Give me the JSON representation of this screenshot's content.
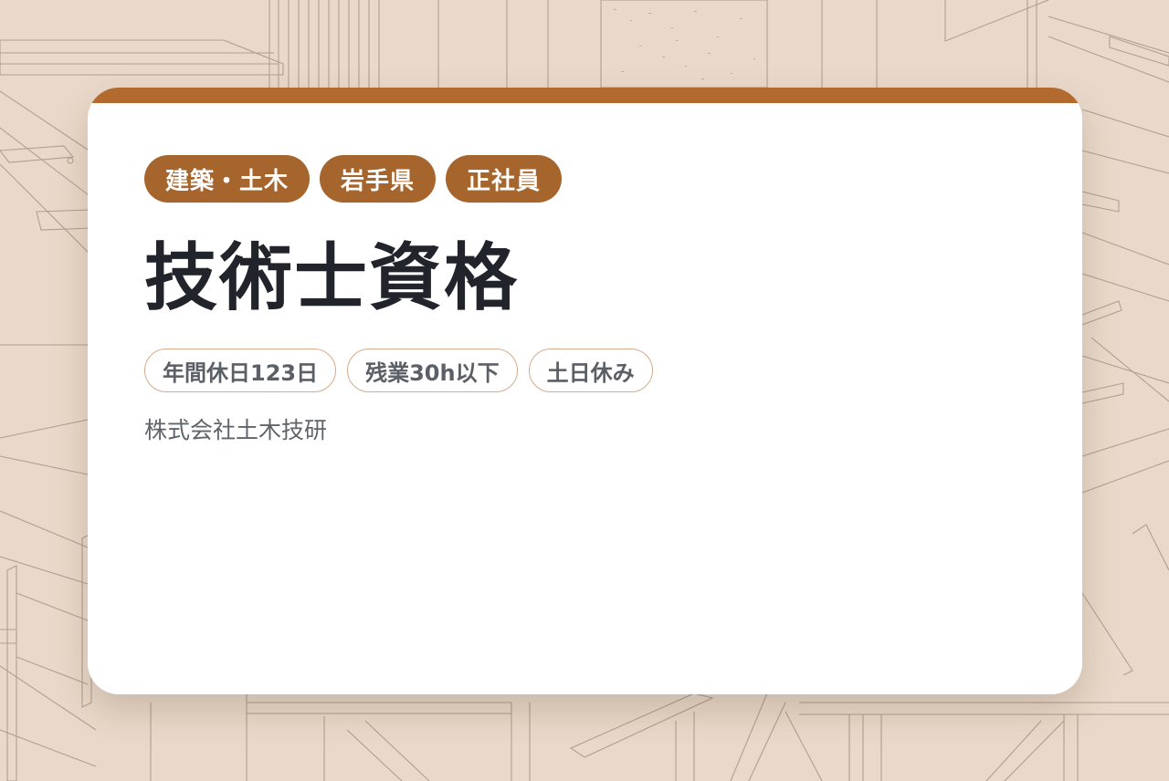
{
  "colors": {
    "background": "#ead9ca",
    "accent": "#b26a2e",
    "tag_background": "#a7652e",
    "title_text": "#21242b",
    "feature_border": "#d7a98a"
  },
  "job": {
    "tags": [
      {
        "label": "建築・土木"
      },
      {
        "label": "岩手県"
      },
      {
        "label": "正社員"
      }
    ],
    "title": "技術士資格",
    "features": [
      {
        "label": "年間休日123日"
      },
      {
        "label": "残業30h以下"
      },
      {
        "label": "土日休み"
      }
    ],
    "company": "株式会社土木技研"
  }
}
